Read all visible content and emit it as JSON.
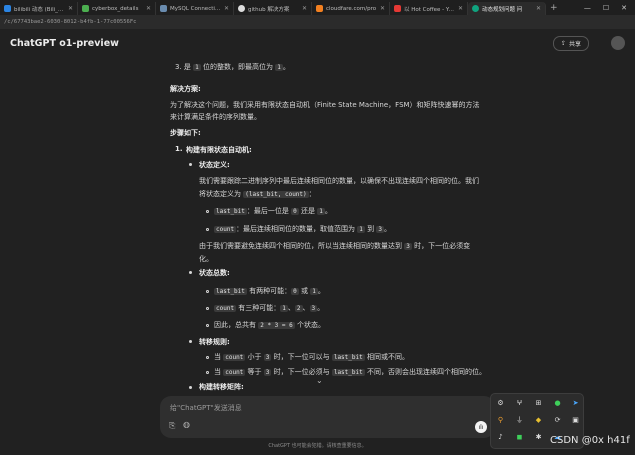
{
  "browser": {
    "tabs": [
      {
        "label": "bilibili 动态 (Bili_Bili)"
      },
      {
        "label": "cyberbox_details"
      },
      {
        "label": "MySQL Connection P"
      },
      {
        "label": "github 解决方案"
      },
      {
        "label": "cloudfare.com/pro"
      },
      {
        "label": "以 Hot Coffee - Youtu"
      },
      {
        "label": "动态规划问题 问"
      }
    ],
    "url": "/c/67743bae2-6030-8012-b4fb-1-77c00556Fc"
  },
  "header": {
    "title": "ChatGPT o1-preview",
    "share_label": "共享"
  },
  "content": {
    "item3_prefix": "3.  是 ",
    "item3_code1": "1",
    "item3_mid": " 位的整数，即最高位为 ",
    "item3_code2": "1",
    "item3_suffix": "。",
    "solution_heading": "解决方案:",
    "solution_line1": "为了解决这个问题，我们采用有限状态自动机（Finite State Machine，FSM）和矩阵快速幂的方法",
    "solution_line2": "来计算满足条件的序列数量。",
    "steps_heading": "步骤如下:",
    "step1_num": "1.",
    "step1_title": "构建有限状态自动机:",
    "state_def_title": "状态定义:",
    "state_def_line1": "我们需要跟踪二进制序列中最后连续相同位的数量，以确保不出现连续四个相同的位。我们",
    "state_def_line2_prefix": "将状态定义为 ",
    "state_def_code": "(last_bit, count)",
    "state_def_line2_suffix": "：",
    "lastbit_code": "last_bit",
    "lastbit_text_a": "：最后一位是 ",
    "lastbit_code_0": "0",
    "lastbit_text_b": " 还是 ",
    "lastbit_code_1": "1",
    "lastbit_text_c": "。",
    "count_code": "count",
    "count_text_a": "：最后连续相同位的数量，取值范围为 ",
    "count_code_1": "1",
    "count_text_b": " 到 ",
    "count_code_3": "3",
    "count_text_c": "。",
    "since_line1_prefix": "由于我们需要避免连续四个相同的位，所以当连续相同的数量达到 ",
    "since_code": "3",
    "since_line1_suffix": " 时，下一位必须变",
    "since_line2": "化。",
    "total_title": "状态总数:",
    "total_a_code": "last_bit",
    "total_a_text_a": " 有两种可能：",
    "total_a_code_0": "0",
    "total_a_text_b": " 或 ",
    "total_a_code_1": "1",
    "total_a_text_c": "。",
    "total_b_code": "count",
    "total_b_text_a": " 有三种可能：",
    "total_b_c1": "1",
    "total_b_sep1": "、",
    "total_b_c2": "2",
    "total_b_sep2": "、",
    "total_b_c3": "3",
    "total_b_text_b": "。",
    "total_c_text_a": "因此，总共有 ",
    "total_c_code": "2 * 3 = 6",
    "total_c_text_b": " 个状态。",
    "trans_title": "转移规则:",
    "trans_a_text_a": "当 ",
    "trans_a_code": "count",
    "trans_a_text_b": " 小于 ",
    "trans_a_code_3": "3",
    "trans_a_text_c": " 时，下一位可以与 ",
    "trans_a_code_lb": "last_bit",
    "trans_a_text_d": " 相同或不同。",
    "trans_b_text_a": "当 ",
    "trans_b_code": "count",
    "trans_b_text_b": " 等于 ",
    "trans_b_code_3": "3",
    "trans_b_text_c": " 时，下一位必须与 ",
    "trans_b_code_lb": "last_bit",
    "trans_b_text_d": " 不同，否则会出现连续四个相同的位。",
    "matrix_title": "构建转移矩阵:"
  },
  "composer": {
    "placeholder": "给\"ChatGPT\"发送消息",
    "disclaimer": "ChatGPT 也可能会犯错。请核查重要信息。"
  },
  "watermark": "CSDN @0x h41f"
}
